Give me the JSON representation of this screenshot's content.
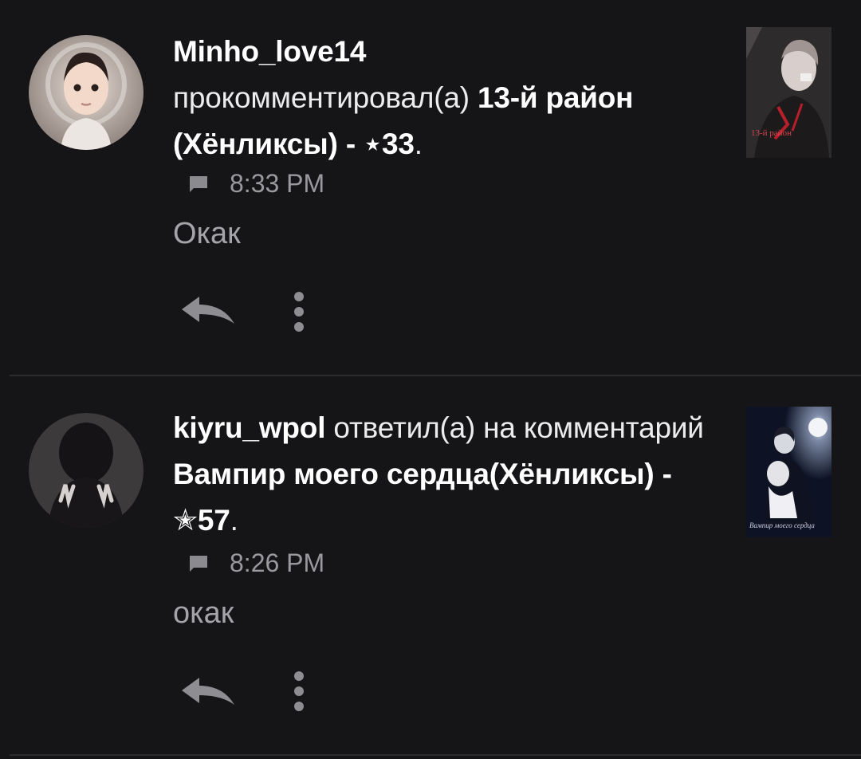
{
  "notifications": [
    {
      "username": "Minho_love14",
      "action": "прокомментировал(а)",
      "story_title": "13-й район (Хёнликсы)",
      "separator": "-",
      "star_glyph": "⋆",
      "rating": "33",
      "end": ".",
      "time": "8:33 PM",
      "comment": "Окак",
      "cover_caption": "13-й район"
    },
    {
      "username": "kiyru_wpol",
      "action": "ответил(а) на комментарий",
      "story_title": "Вампир моего сердца(Хёнликсы)",
      "separator": "-",
      "star_glyph": "✭",
      "rating": "57",
      "end": ".",
      "time": "8:26 PM",
      "comment": "окак",
      "cover_caption": "Вампир моего сердца"
    }
  ],
  "icons": {
    "comment": "comment-icon",
    "reply": "reply-icon",
    "more": "more-vertical-icon"
  },
  "colors": {
    "background": "#151417",
    "text": "#ececee",
    "muted": "#9a999e",
    "divider": "#2c2b2f"
  }
}
